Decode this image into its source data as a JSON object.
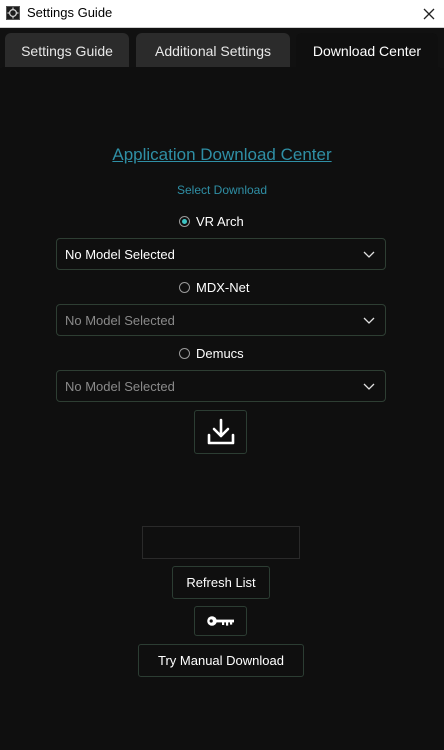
{
  "window": {
    "title": "Settings Guide",
    "icon": "app-logo-icon",
    "close_icon": "close-icon"
  },
  "tabs": [
    {
      "label": "Settings Guide",
      "active": false
    },
    {
      "label": "Additional Settings",
      "active": false
    },
    {
      "label": "Download Center",
      "active": true
    }
  ],
  "download_center": {
    "header": "Application Download Center",
    "select_label": "Select Download",
    "options": [
      {
        "label": "VR Arch",
        "selected": true,
        "dropdown_value": "No Model Selected"
      },
      {
        "label": "MDX-Net",
        "selected": false,
        "dropdown_value": "No Model Selected"
      },
      {
        "label": "Demucs",
        "selected": false,
        "dropdown_value": "No Model Selected"
      }
    ],
    "download_icon": "download-icon",
    "input_value": "",
    "refresh_label": "Refresh List",
    "key_icon": "key-icon",
    "manual_label": "Try Manual Download"
  },
  "colors": {
    "accent": "#2f8fa5",
    "background": "#0f0f0f",
    "radio_selected": "#3ec5c5",
    "border": "#2e3e33"
  }
}
